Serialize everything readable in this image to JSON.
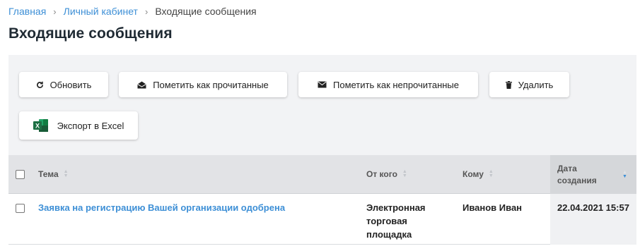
{
  "breadcrumb": {
    "items": [
      "Главная",
      "Личный кабинет"
    ],
    "current": "Входящие сообщения"
  },
  "page_title": "Входящие сообщения",
  "toolbar": {
    "refresh_label": "Обновить",
    "mark_read_label": "Пометить как прочитанные",
    "mark_unread_label": "Пометить как непрочитанные",
    "delete_label": "Удалить",
    "export_label": "Экспорт в Excel"
  },
  "table": {
    "columns": {
      "subject": "Тема",
      "from": "От кого",
      "to": "Кому",
      "date": "Дата создания"
    },
    "sorted_column": "date",
    "rows": [
      {
        "subject": "Заявка на регистрацию Вашей организации одобрена",
        "from": "Электронная торговая площадка",
        "to": "Иванов Иван",
        "date": "22.04.2021 15:57"
      }
    ]
  },
  "colors": {
    "link": "#3d8fd6",
    "excel_green": "#1d7044",
    "panel_bg": "#f2f3f5",
    "header_bg": "#e2e3e6"
  }
}
